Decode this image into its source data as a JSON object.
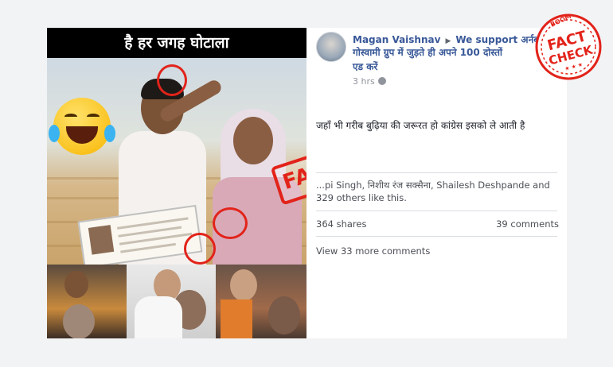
{
  "meme": {
    "header_text": "है हर जगह घोटाला",
    "stamp_text": "FAKE"
  },
  "post": {
    "author": "Magan Vaishnav",
    "group_line1": "We support अर्नब",
    "group_line2": "गोस्वामी ग्रुप में जुड़ते ही अपने 100 दोस्तों",
    "group_line3": "एड करें",
    "time": "3 hrs",
    "text": "जहाँ भी गरीब बुढ़िया की जरूरत हो कांग्रेस इसको ले आती है",
    "likes_text": "...pi Singh, निशीथ रंज सक्सैना, Shailesh Deshpande and 329 others like this.",
    "shares": "364 shares",
    "comments": "39 comments",
    "view_more": "View 33 more comments"
  },
  "badge": {
    "top_text": "BOOM",
    "line1": "FACT",
    "line2": "CHECK",
    "stars": "★ ★ ★"
  },
  "colors": {
    "link": "#385898",
    "stamp_red": "#e2231a",
    "muted": "#90949c"
  },
  "icons": [
    "laughing-emoji-icon",
    "globe-icon",
    "caret-right-icon"
  ]
}
